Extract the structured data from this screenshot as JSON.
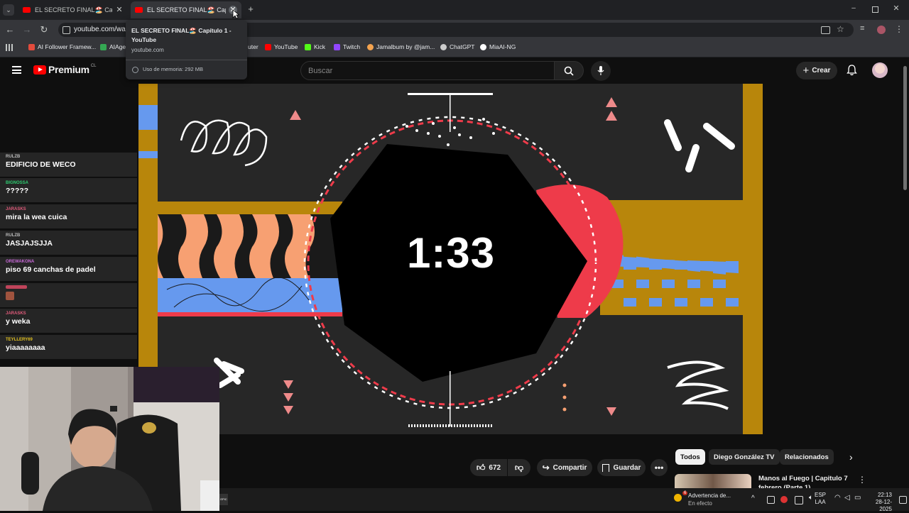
{
  "browser": {
    "tabs": [
      {
        "title": "EL SECRETO FINAL🏖️ Capítulo 1 - YouTube",
        "short": "EL SECRETO FINAL🏖️ Capítulo",
        "close": "✕"
      },
      {
        "title": "EL SECRETO FINAL🏖️ Capítulo 1 - YouTube",
        "short": "EL SECRETO FINAL🏖️ Capítulo",
        "close": "✕"
      }
    ],
    "new_tab": "+",
    "url": "youtube.com/wat",
    "tooltip": {
      "title": "EL SECRETO FINAL🏖️ Capítulo 1 - YouTube",
      "domain": "youtube.com",
      "memory": "Uso de memoria: 292 MB"
    },
    "bookmarks": [
      {
        "label": "AI Follower Framew...",
        "color": "#e34b3c"
      },
      {
        "label": "AIAge",
        "color": "#34a853"
      },
      {
        "label": "uter",
        "color": "#888888"
      },
      {
        "label": "YouTube",
        "color": "#ff0000"
      },
      {
        "label": "Kick",
        "color": "#53fc18"
      },
      {
        "label": "Twitch",
        "color": "#9146ff"
      },
      {
        "label": "Jamalbum by @jam...",
        "color": "#f4a34f"
      },
      {
        "label": "ChatGPT",
        "color": "#cccccc"
      },
      {
        "label": "MiaAI-NG",
        "color": "#ffffff"
      }
    ]
  },
  "youtube": {
    "logo": "Premium",
    "logo_country": "CL",
    "search_placeholder": "Buscar",
    "create_label": "Crear"
  },
  "video": {
    "timer": "1:33",
    "colors": {
      "mustard": "#b8860b",
      "blue": "#6699ee",
      "salmon": "#f7a072",
      "red": "#ee3b4a",
      "dark": "#272727"
    }
  },
  "chat": [
    {
      "user": "RULZB",
      "user_color": "#bbbbbb",
      "message": "EDIFICIO DE WECO"
    },
    {
      "user": "BIGNOSSA",
      "user_color": "#2ecc71",
      "message": "?????"
    },
    {
      "user": "JARASKS",
      "user_color": "#e05a7a",
      "message": "mira la wea cuica"
    },
    {
      "user": "RULZB",
      "user_color": "#bbbbbb",
      "message": "JASJAJSJJA"
    },
    {
      "user": "OREWAKONA",
      "user_color": "#c96ad8",
      "message": "piso 69 canchas de padel"
    },
    {
      "user": "JARASKS",
      "user_color": "#e05a7a",
      "message": "y weka"
    },
    {
      "user": "TEYLLERY69",
      "user_color": "#e0c020",
      "message": "yiaaaaaaaa"
    }
  ],
  "actions": {
    "likes": "672",
    "share": "Compartir",
    "save": "Guardar"
  },
  "chips": [
    "Todos",
    "Diego González TV",
    "Relacionados"
  ],
  "recommended": {
    "title": "Manos al Fuego | Capitulo 7",
    "subtitle": "febrero (Parte 1)"
  },
  "taskbar": {
    "weather_title": "Advertencia de...",
    "weather_sub": "En efecto",
    "weather_badge": "6",
    "lang_top": "ESP",
    "lang_bottom": "LAA",
    "time": "22:13",
    "date": "28-12-2025",
    "epic": "EPIC"
  }
}
